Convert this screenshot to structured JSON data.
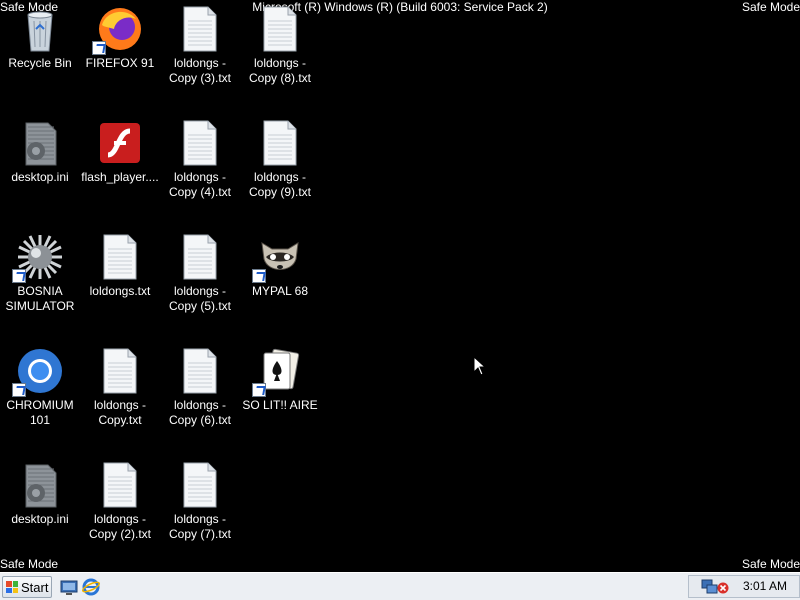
{
  "screen": {
    "build_text": "Microsoft (R) Windows (R) (Build 6003: Service Pack 2)",
    "safe_mode_tl": "Safe Mode",
    "safe_mode_tr": "Safe Mode",
    "safe_mode_bl": "Safe Mode",
    "safe_mode_br": "Safe Mode"
  },
  "icons": [
    {
      "label": "Recycle Bin",
      "icon": "recycle-bin-icon"
    },
    {
      "label": "FIREFOX 91",
      "icon": "firefox-icon"
    },
    {
      "label": "loldongs - Copy (3).txt",
      "icon": "text-file-icon"
    },
    {
      "label": "loldongs - Copy (8).txt",
      "icon": "text-file-icon"
    },
    {
      "label": "desktop.ini",
      "icon": "settings-file-icon"
    },
    {
      "label": "flash_player....",
      "icon": "flash-player-icon"
    },
    {
      "label": "loldongs - Copy (4).txt",
      "icon": "text-file-icon"
    },
    {
      "label": "loldongs - Copy (9).txt",
      "icon": "text-file-icon"
    },
    {
      "label": "BOSNIA SIMULATOR",
      "icon": "spiked-ball-icon"
    },
    {
      "label": "loldongs.txt",
      "icon": "text-file-icon"
    },
    {
      "label": "loldongs - Copy (5).txt",
      "icon": "text-file-icon"
    },
    {
      "label": "MYPAL 68",
      "icon": "raccoon-icon"
    },
    {
      "label": "CHROMIUM 101",
      "icon": "chromium-icon"
    },
    {
      "label": "loldongs - Copy.txt",
      "icon": "text-file-icon"
    },
    {
      "label": "loldongs - Copy (6).txt",
      "icon": "text-file-icon"
    },
    {
      "label": "SO LIT!! AIRE",
      "icon": "solitaire-cards-icon"
    },
    {
      "label": "desktop.ini",
      "icon": "settings-file-icon"
    },
    {
      "label": "loldongs - Copy (2).txt",
      "icon": "text-file-icon"
    },
    {
      "label": "loldongs - Copy (7).txt",
      "icon": "text-file-icon"
    }
  ],
  "taskbar": {
    "start_label": "Start",
    "clock": "3:01 AM"
  }
}
